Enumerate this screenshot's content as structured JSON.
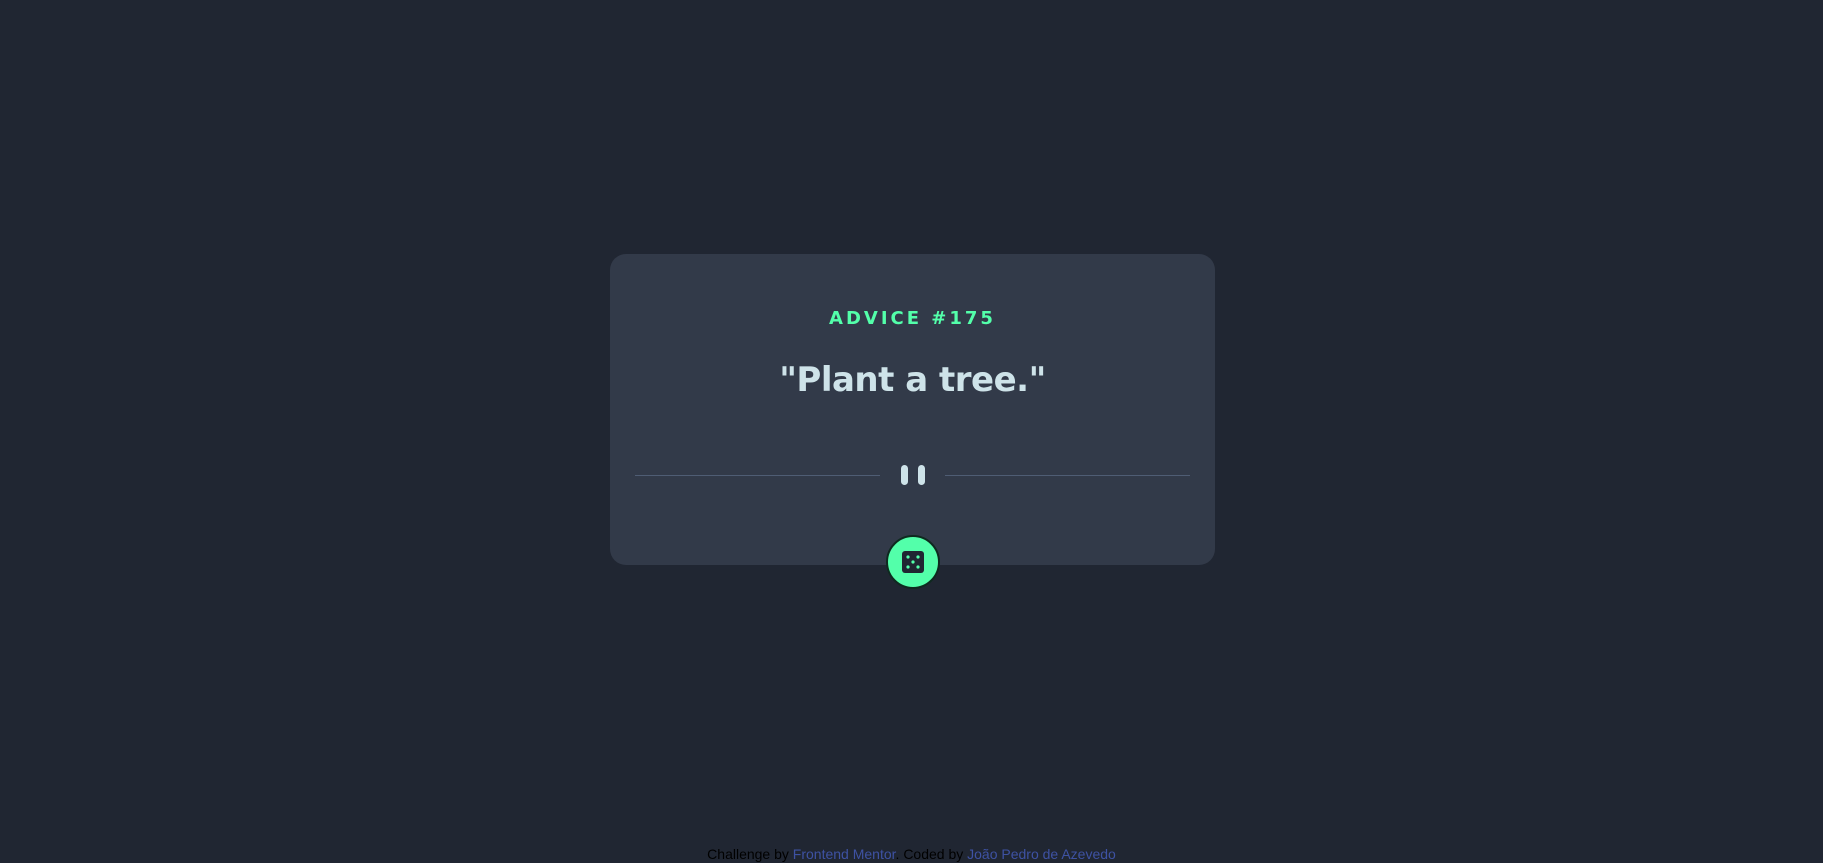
{
  "advice": {
    "label": "ADVICE #175",
    "quote": "\"Plant a tree.\""
  },
  "divider": {
    "icon": "pause-icon"
  },
  "dice_button": {
    "icon": "dice-icon"
  },
  "footer": {
    "challenge_prefix": "Challenge by",
    "challenge_link": "Frontend Mentor",
    "separator": ".",
    "coded_prefix": "Coded by",
    "coded_link": "João Pedro de Azevedo"
  },
  "colors": {
    "background": "#202632",
    "card": "#323a49",
    "accent": "#53ffaa",
    "text": "#cee3e9",
    "divider": "#4f5d74",
    "link": "#3e52a3"
  }
}
